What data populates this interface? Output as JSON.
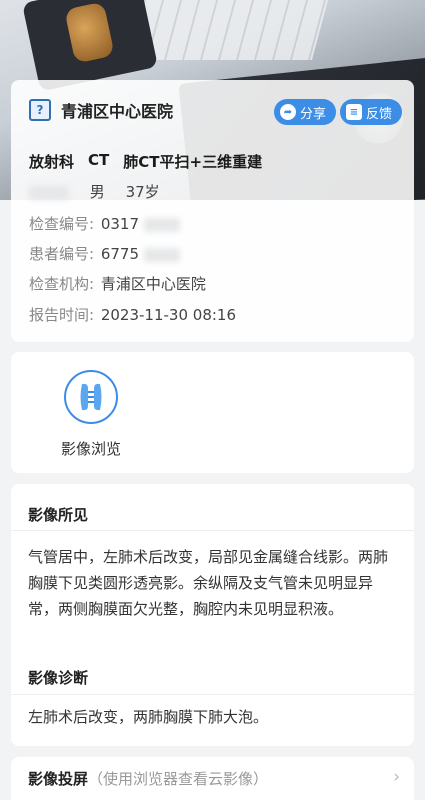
{
  "header": {
    "hospital_icon": "hospital-logo-icon",
    "hospital_icon_glyph": "?",
    "hospital_name": "青浦区中心医院",
    "share_label": "分享",
    "feedback_label": "反馈",
    "accent_color": "#3b8de6"
  },
  "exam": {
    "department": "放射科",
    "modality": "CT",
    "item": "肺CT平扫+三维重建"
  },
  "patient": {
    "gender": "男",
    "age": "37岁",
    "exam_no_label": "检查编号:",
    "exam_no_value": "0317",
    "patient_no_label": "患者编号:",
    "patient_no_value": "6775",
    "institution_label": "检查机构:",
    "institution_value": "青浦区中心医院",
    "report_time_label": "报告时间:",
    "report_time_value": "2023-11-30 08:16"
  },
  "viewer": {
    "label": "影像浏览",
    "icon": "image-viewer-icon"
  },
  "findings": {
    "title": "影像所见",
    "text": "气管居中，左肺术后改变，局部见金属缝合线影。两肺胸膜下见类圆形透亮影。余纵隔及支气管未见明显异常，两侧胸膜面欠光整，胸腔内未见明显积液。"
  },
  "diagnosis": {
    "title": "影像诊断",
    "text": "左肺术后改变，两肺胸膜下肺大泡。"
  },
  "projection": {
    "title": "影像投屏",
    "subtitle": "（使用浏览器查看云影像）",
    "chevron": "›"
  }
}
